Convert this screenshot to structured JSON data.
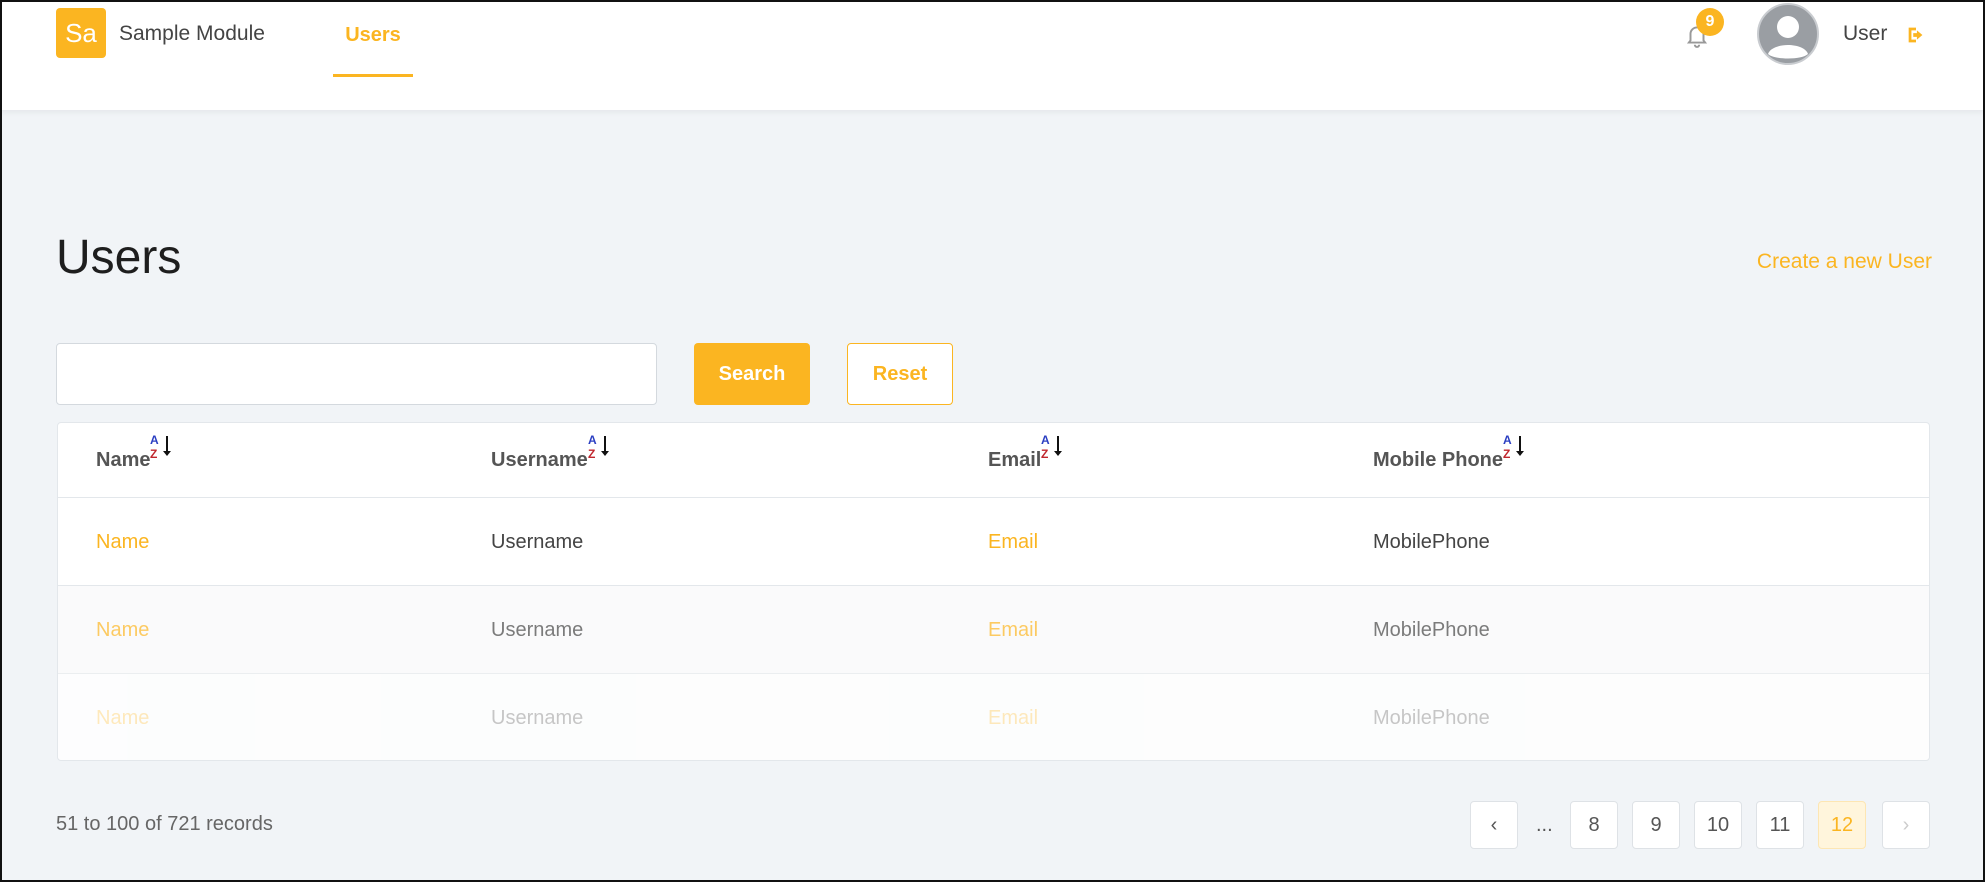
{
  "header": {
    "logo_text": "Sa",
    "module_name": "Sample Module",
    "nav_tab": "Users",
    "notification_count": "9",
    "user_label": "User"
  },
  "page": {
    "title": "Users",
    "create_link": "Create a new User"
  },
  "search": {
    "value": "",
    "placeholder": "",
    "search_label": "Search",
    "reset_label": "Reset"
  },
  "table": {
    "columns": [
      "Name",
      "Username",
      "Email",
      "Mobile Phone"
    ],
    "rows": [
      [
        "Name",
        "Username",
        "Email",
        "MobilePhone"
      ],
      [
        "Name",
        "Username",
        "Email",
        "MobilePhone"
      ],
      [
        "Name",
        "Username",
        "Email",
        "MobilePhone"
      ]
    ]
  },
  "footer": {
    "records_text": "51 to 100 of 721 records",
    "pagination": {
      "prev": "‹",
      "ellipsis": "...",
      "pages": [
        "8",
        "9",
        "10",
        "11",
        "12"
      ],
      "active": "12",
      "next": "›"
    }
  },
  "colors": {
    "accent": "#fbb521",
    "background": "#f1f4f7"
  }
}
